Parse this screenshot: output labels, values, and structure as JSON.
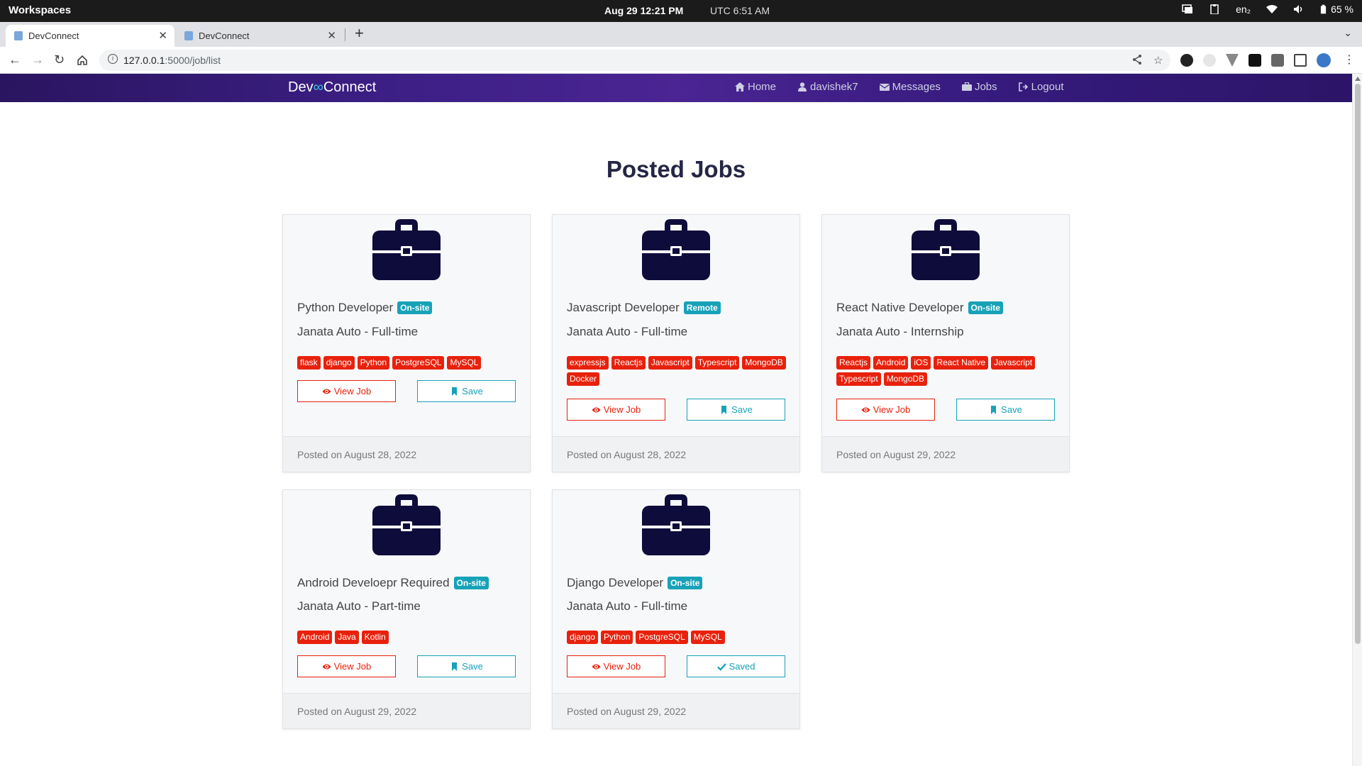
{
  "os": {
    "workspaces": "Workspaces",
    "datetime": "Aug 29  12:21 PM",
    "utc": "UTC 6:51 AM",
    "lang": "en₂",
    "battery": "65 %"
  },
  "browser": {
    "tabs": [
      {
        "title": "DevConnect",
        "active": true
      },
      {
        "title": "DevConnect",
        "active": false
      }
    ],
    "url_host": "127.0.0.1",
    "url_path": ":5000/job/list"
  },
  "site": {
    "brand_left": "Dev",
    "brand_right": "Connect",
    "nav": {
      "home": "Home",
      "user": "davishek7",
      "messages": "Messages",
      "jobs": "Jobs",
      "logout": "Logout"
    }
  },
  "page": {
    "title": "Posted Jobs",
    "view_label": "View Job",
    "save_label": "Save",
    "saved_label": "Saved"
  },
  "jobs": [
    {
      "title": "Python Developer",
      "mode": "On-site",
      "company_line": "Janata Auto - Full-time",
      "tags": [
        "flask",
        "django",
        "Python",
        "PostgreSQL",
        "MySQL"
      ],
      "saved": false,
      "posted": "Posted on August 28, 2022"
    },
    {
      "title": "Javascript Developer",
      "mode": "Remote",
      "company_line": "Janata Auto - Full-time",
      "tags": [
        "expressjs",
        "Reactjs",
        "Javascript",
        "Typescript",
        "MongoDB",
        "Docker"
      ],
      "saved": false,
      "posted": "Posted on August 28, 2022"
    },
    {
      "title": "React Native Developer",
      "mode": "On-site",
      "company_line": "Janata Auto - Internship",
      "tags": [
        "Reactjs",
        "Android",
        "iOS",
        "React Native",
        "Javascript",
        "Typescript",
        "MongoDB"
      ],
      "saved": false,
      "posted": "Posted on August 29, 2022"
    },
    {
      "title": "Android Develoepr Required",
      "mode": "On-site",
      "company_line": "Janata Auto - Part-time",
      "tags": [
        "Android",
        "Java",
        "Kotlin"
      ],
      "saved": false,
      "posted": "Posted on August 29, 2022"
    },
    {
      "title": "Django Developer",
      "mode": "On-site",
      "company_line": "Janata Auto - Full-time",
      "tags": [
        "django",
        "Python",
        "PostgreSQL",
        "MySQL"
      ],
      "saved": true,
      "posted": "Posted on August 29, 2022"
    }
  ],
  "colors": {
    "tag": "#e8210c",
    "badge": "#17a2b8",
    "icon": "#0e0c3a"
  }
}
